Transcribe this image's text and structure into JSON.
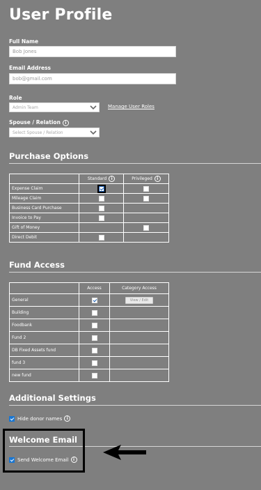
{
  "page_title": "User Profile",
  "full_name": {
    "label": "Full Name",
    "value": "Bob Jones"
  },
  "email": {
    "label": "Email Address",
    "value": "bob@gmail.com"
  },
  "role": {
    "label": "Role",
    "selected": "Admin Team",
    "link": "Manage User Roles"
  },
  "spouse": {
    "label": "Spouse / Relation",
    "placeholder": "Select Spouse / Relation"
  },
  "purchase_options": {
    "title": "Purchase Options",
    "headers": [
      "",
      "Standard",
      "Privileged"
    ],
    "rows": [
      {
        "name": "Expense Claim",
        "standard": true,
        "privileged": false
      },
      {
        "name": "Mileage Claim",
        "standard": false,
        "privileged": false
      },
      {
        "name": "Business Card Purchase",
        "standard": false,
        "privileged": null
      },
      {
        "name": "Invoice to Pay",
        "standard": false,
        "privileged": null
      },
      {
        "name": "Gift of Money",
        "standard": null,
        "privileged": false
      },
      {
        "name": "Direct Debit",
        "standard": false,
        "privileged": null
      }
    ]
  },
  "fund_access": {
    "title": "Fund Access",
    "headers": [
      "",
      "Access",
      "Category Access"
    ],
    "view_edit_label": "View / Edit",
    "rows": [
      {
        "name": "General",
        "access": true
      },
      {
        "name": "Building",
        "access": false
      },
      {
        "name": "Foodbank",
        "access": false
      },
      {
        "name": "Fund 2",
        "access": false
      },
      {
        "name": "DB Fixed Assets fund",
        "access": false
      },
      {
        "name": "fund 3",
        "access": false
      },
      {
        "name": "new fund",
        "access": false
      }
    ]
  },
  "additional_settings": {
    "title": "Additional Settings",
    "hide_donor_names": "Hide donor names"
  },
  "welcome_email": {
    "title": "Welcome Email",
    "send_label": "Send Welcome Email"
  },
  "colors": {
    "background": "#7f7f7f",
    "checkbox_blue": "#1976d2"
  }
}
